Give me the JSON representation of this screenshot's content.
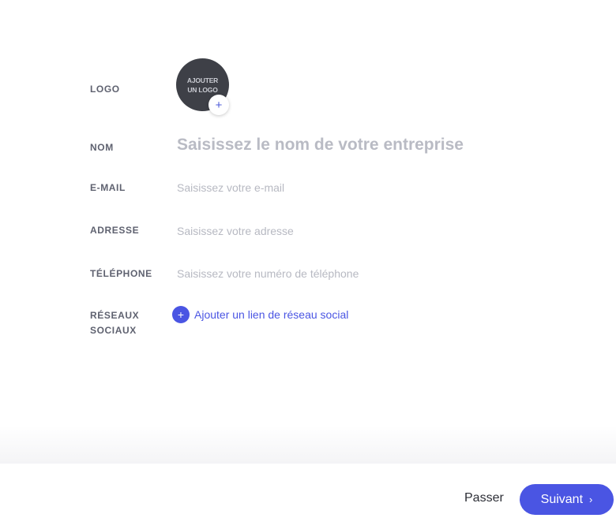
{
  "form": {
    "logo": {
      "label": "LOGO",
      "placeholder_line1": "AJOUTER",
      "placeholder_line2": "UN LOGO",
      "add_icon": "+"
    },
    "name": {
      "label": "NOM",
      "placeholder": "Saisissez le nom de votre entreprise"
    },
    "email": {
      "label": "E-MAIL",
      "placeholder": "Saisissez votre e-mail"
    },
    "address": {
      "label": "ADRESSE",
      "placeholder": "Saisissez votre adresse"
    },
    "phone": {
      "label": "TÉLÉPHONE",
      "placeholder": "Saisissez votre numéro de téléphone"
    },
    "social": {
      "label_line1": "RÉSEAUX",
      "label_line2": "SOCIAUX",
      "add_icon": "+",
      "add_label": "Ajouter un lien de réseau social"
    }
  },
  "footer": {
    "skip_label": "Passer",
    "next_label": "Suivant",
    "next_icon": "›"
  },
  "colors": {
    "accent": "#4a55e3",
    "label": "#5f6270",
    "placeholder": "#b7b9c2",
    "logo_bg": "#3e4047"
  }
}
